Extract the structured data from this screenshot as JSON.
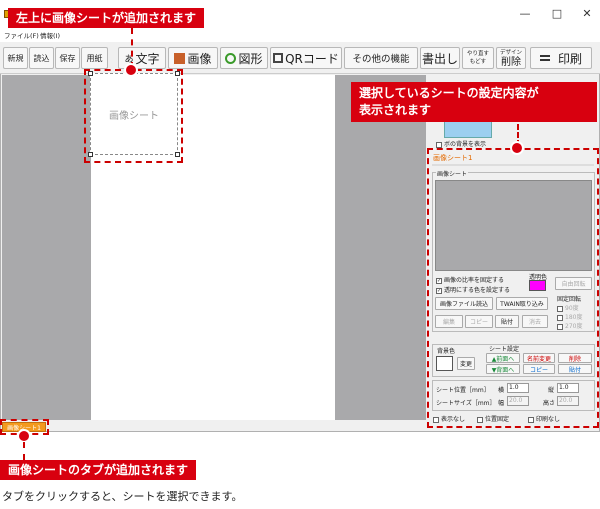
{
  "app": {
    "menu": [
      "ファイル(F)",
      "情報(I)"
    ],
    "window_controls": [
      "—",
      "□",
      "✕"
    ]
  },
  "toolbar": {
    "new": "新規",
    "load": "読込",
    "save": "保存",
    "paper": "用紙",
    "text": "文字",
    "text_glyph": "あ",
    "image": "画像",
    "shape": "図形",
    "qr": "QRコード",
    "other": "その他の機能",
    "write": "書出し",
    "redo": "やり直す",
    "undo": "もどす",
    "delete_top": "デザイン",
    "delete": "削除",
    "print": "印刷"
  },
  "canvas": {
    "sheet_label": "画像シート",
    "left_edge": "画",
    "check_label": "ボの背景を表示"
  },
  "callouts": {
    "top_left": "左上に画像シートが追加されます",
    "panel": "選択しているシートの設定内容が",
    "panel2": "表示されます",
    "tab": "画像シートのタブが追加されます",
    "note": "タブをクリックすると、シートを選択できます。"
  },
  "panel": {
    "title": "画像シート1",
    "group": "画像シート",
    "fix_ratio": "画像の比率を固定する",
    "transparent": "透明にする色を設定する",
    "transparent_color_label": "透明色",
    "transparent_color": "#ff00ff",
    "free_rotate": "自由回転",
    "load_file": "画像ファイル読込",
    "twain": "TWAIN取り込み",
    "fixed_rotate": "固定回転",
    "r90": "90度",
    "r180": "180度",
    "r270": "270度",
    "edit": "編集",
    "copy": "コピー",
    "paste": "貼付",
    "clear": "消去",
    "bg_label": "背景色",
    "bg_change": "変更",
    "sheet_settings": "シート設定",
    "front": "▲前面へ",
    "back": "▼背面へ",
    "rename": "名前変更",
    "copy2": "コピー",
    "delete": "削除",
    "paste2": "貼付",
    "position": "シート位置［mm］",
    "pos_x_label": "横",
    "pos_x": "1.0",
    "pos_y_label": "縦",
    "pos_y": "1.0",
    "size": "シートサイズ［mm］",
    "width_label": "幅",
    "width": "20.0",
    "height_label": "高さ",
    "height": "20.0",
    "hide": "表示なし",
    "lock": "位置固定",
    "noprint": "印刷なし"
  },
  "tab": {
    "label": "画像シート1"
  }
}
